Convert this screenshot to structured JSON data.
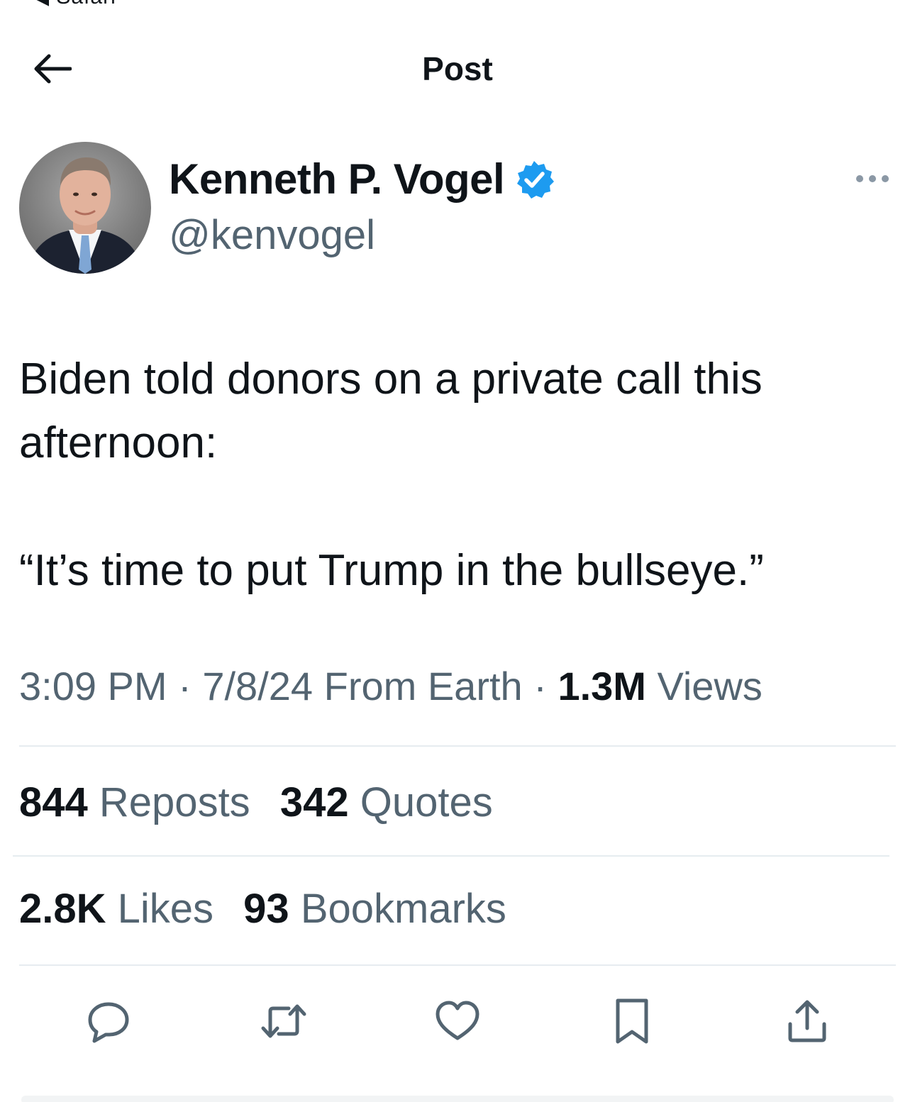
{
  "status_bar": {
    "back_app_label": "Safari"
  },
  "header": {
    "title": "Post"
  },
  "author": {
    "name": "Kenneth P. Vogel",
    "handle": "@kenvogel",
    "verified": true
  },
  "post": {
    "line1": "Biden told donors on a private call this afternoon:",
    "line2": "“It’s time to put Trump in the bullseye.”"
  },
  "meta": {
    "time": "3:09 PM",
    "separator": "·",
    "date": "7/8/24",
    "source": "From Earth",
    "views_count": "1.3M",
    "views_label": "Views"
  },
  "stats": {
    "reposts_count": "844",
    "reposts_label": "Reposts",
    "quotes_count": "342",
    "quotes_label": "Quotes",
    "likes_count": "2.8K",
    "likes_label": "Likes",
    "bookmarks_count": "93",
    "bookmarks_label": "Bookmarks"
  },
  "actions": [
    "reply-icon",
    "repost-icon",
    "like-icon",
    "bookmark-icon",
    "share-icon"
  ],
  "colors": {
    "text": "#0f1419",
    "secondary": "#536471",
    "verified": "#1d9bf0",
    "divider": "#e6ecf0"
  }
}
